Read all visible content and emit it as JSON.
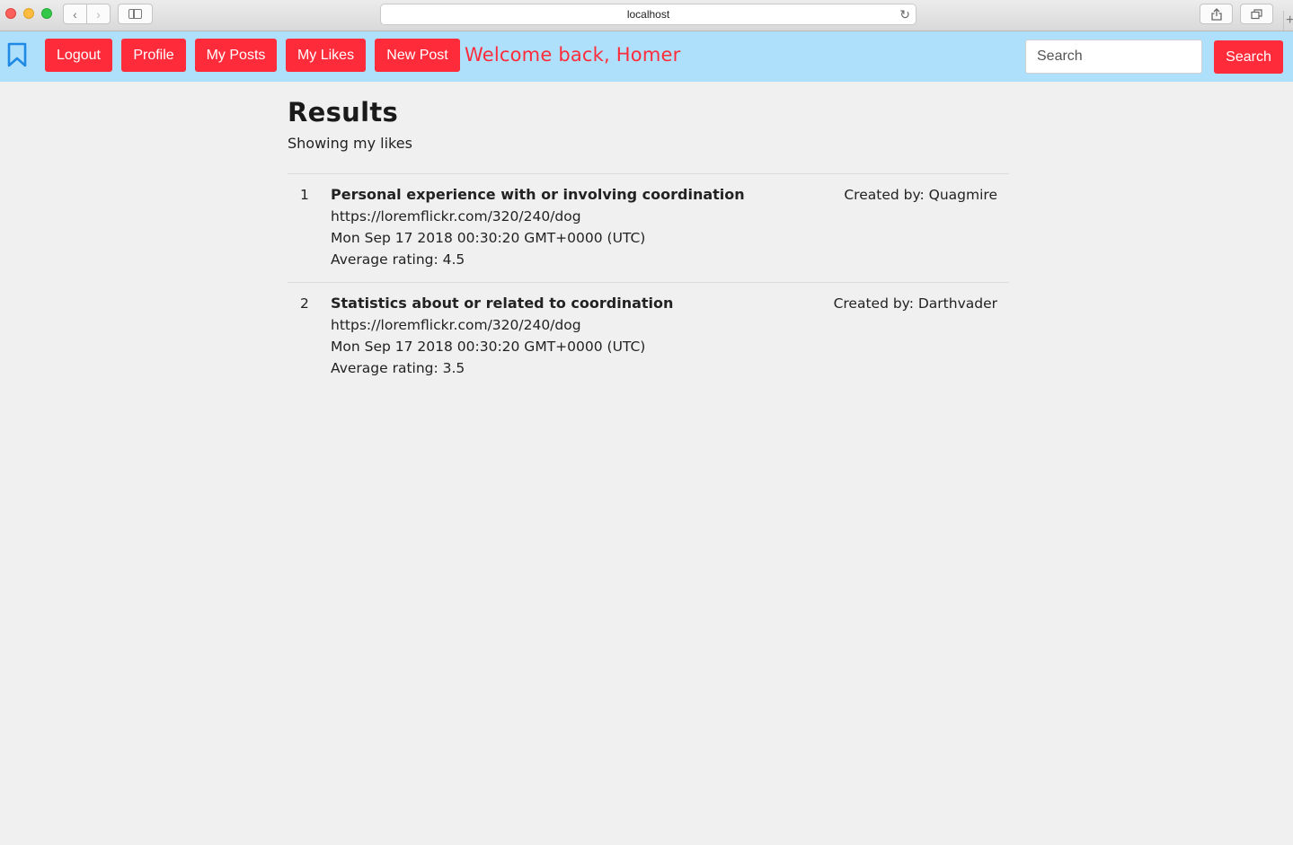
{
  "browser": {
    "url": "localhost",
    "back_icon": "chevron-left-icon",
    "forward_icon": "chevron-right-icon",
    "reload_icon": "reload-icon",
    "share_icon": "share-icon",
    "tabs_icon": "tabs-overview-icon",
    "new_tab_icon": "plus-icon"
  },
  "navbar": {
    "background": "#aee0fb",
    "accent": "#fe2c3b",
    "logo_icon": "bookmark-icon",
    "buttons": {
      "logout": "Logout",
      "profile": "Profile",
      "my_posts": "My Posts",
      "my_likes": "My Likes",
      "new_post": "New Post"
    },
    "welcome": "Welcome back, Homer",
    "search": {
      "placeholder": "Search",
      "value": "",
      "button_label": "Search"
    }
  },
  "main": {
    "title": "Results",
    "subtitle": "Showing my likes",
    "results": [
      {
        "index": "1",
        "title": "Personal experience with or involving coordination",
        "url": "https://loremflickr.com/320/240/dog",
        "date": "Mon Sep 17 2018 00:30:20 GMT+0000 (UTC)",
        "rating": "Average rating: 4.5",
        "author": "Created by: Quagmire"
      },
      {
        "index": "2",
        "title": "Statistics about or related to coordination",
        "url": "https://loremflickr.com/320/240/dog",
        "date": "Mon Sep 17 2018 00:30:20 GMT+0000 (UTC)",
        "rating": "Average rating: 3.5",
        "author": "Created by: Darthvader"
      }
    ]
  }
}
